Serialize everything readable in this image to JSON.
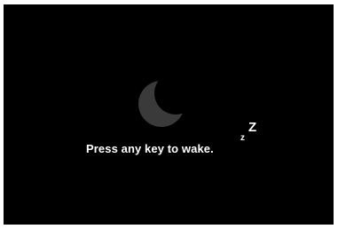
{
  "sleep_screen": {
    "message": "Press any key to wake.",
    "snore_small": "z",
    "snore_large": "Z",
    "icon": "moon-icon",
    "colors": {
      "background": "#000000",
      "moon": "#3a3a3a",
      "text": "#ffffff"
    }
  }
}
